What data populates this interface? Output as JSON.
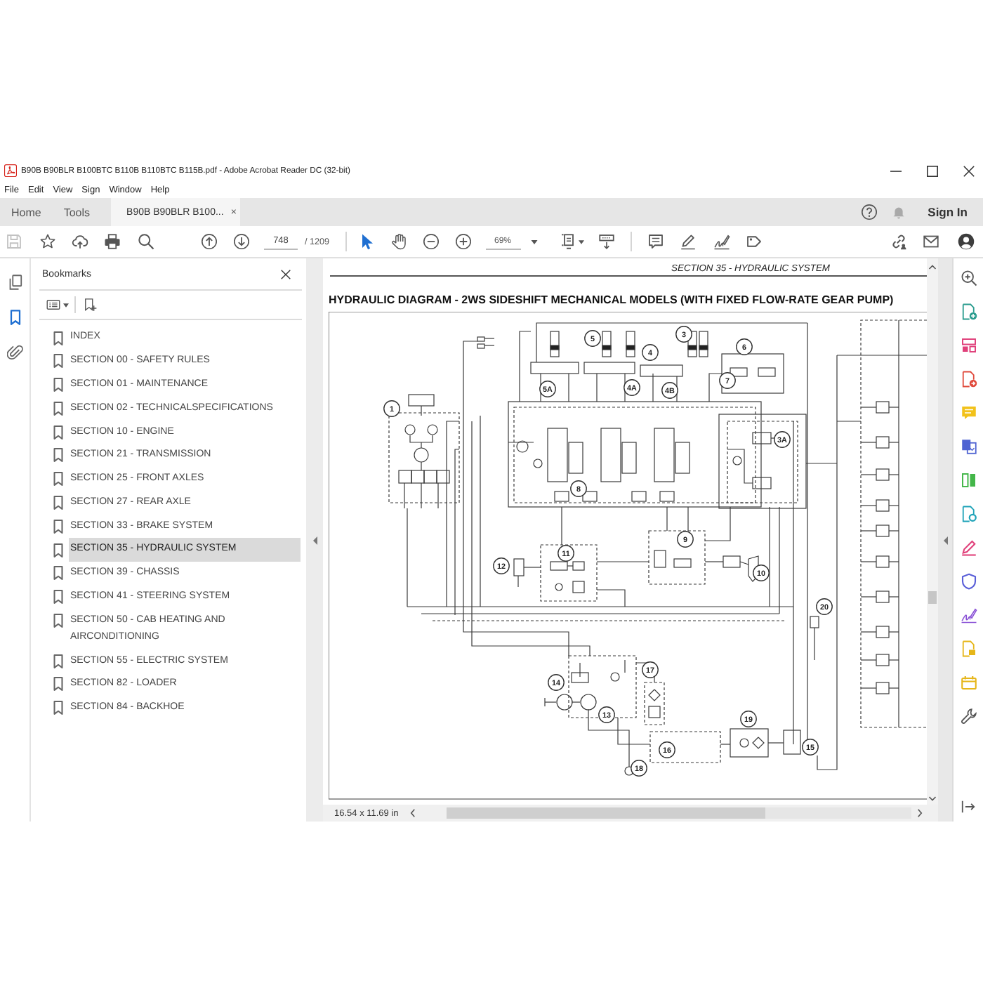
{
  "window": {
    "title": "B90B B90BLR B100BTC B110B B110BTC B115B.pdf - Adobe Acrobat Reader DC (32-bit)"
  },
  "menu": [
    "File",
    "Edit",
    "View",
    "Sign",
    "Window",
    "Help"
  ],
  "tabs": [
    {
      "label": "Home",
      "kind": "nav",
      "selected": false
    },
    {
      "label": "Tools",
      "kind": "nav",
      "selected": false
    },
    {
      "label": "B90B B90BLR B100...",
      "kind": "document",
      "selected": true,
      "close": "×"
    }
  ],
  "account": {
    "label": "Sign In"
  },
  "toolbar": {
    "save": {
      "disabled": true
    },
    "page": "748",
    "page_count": "/ 1209",
    "zoom": "69%",
    "tools": [
      {
        "kind": "select",
        "selected": true
      },
      {
        "kind": "hand",
        "selected": false
      }
    ]
  },
  "nav_panel": [
    {
      "kind": "pages",
      "selected": false
    },
    {
      "kind": "bookmarks",
      "selected": true
    },
    {
      "kind": "attachments",
      "selected": false
    }
  ],
  "bookmarks": {
    "title": "Bookmarks",
    "items": [
      {
        "label": "INDEX",
        "selected": false
      },
      {
        "label": "SECTION 00 - SAFETY RULES",
        "selected": false
      },
      {
        "label": "SECTION 01 - MAINTENANCE",
        "selected": false
      },
      {
        "label": "SECTION 02 - TECHNICALSPECIFICATIONS",
        "selected": false
      },
      {
        "label": "SECTION 10 - ENGINE",
        "selected": false
      },
      {
        "label": "SECTION 21 - TRANSMISSION",
        "selected": false
      },
      {
        "label": "SECTION 25 - FRONT AXLES",
        "selected": false
      },
      {
        "label": "SECTION 27 - REAR AXLE",
        "selected": false
      },
      {
        "label": "SECTION 33 - BRAKE SYSTEM",
        "selected": false
      },
      {
        "label": "SECTION 35 - HYDRAULIC SYSTEM",
        "selected": true
      },
      {
        "label": "SECTION 39 - CHASSIS",
        "selected": false
      },
      {
        "label": "SECTION 41 - STEERING SYSTEM",
        "selected": false
      },
      {
        "label": "SECTION 50 - CAB HEATING AND AIRCONDITIONING",
        "selected": false
      },
      {
        "label": "SECTION 55 - ELECTRIC SYSTEM",
        "selected": false
      },
      {
        "label": "SECTION 82 - LOADER",
        "selected": false
      },
      {
        "label": "SECTION 84 - BACKHOE",
        "selected": false
      }
    ]
  },
  "document": {
    "header": "SECTION 35 - HYDRAULIC SYSTEM",
    "title": "HYDRAULIC DIAGRAM - 2WS SIDESHIFT MECHANICAL MODELS (WITH FIXED FLOW-RATE GEAR PUMP)",
    "callouts": [
      "1",
      "5",
      "4",
      "3",
      "5A",
      "4A",
      "4B",
      "6",
      "7",
      "3A",
      "8",
      "9",
      "10",
      "11",
      "12",
      "14",
      "13",
      "17",
      "18",
      "20",
      "19",
      "16",
      "15"
    ]
  },
  "status_bar": {
    "page_size": "16.54 x 11.69 in"
  }
}
